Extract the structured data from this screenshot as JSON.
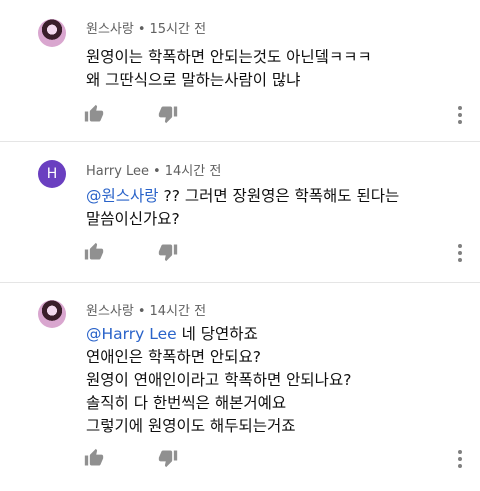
{
  "comments": [
    {
      "author": "원스사랑",
      "separator": "•",
      "time": "15시간 전",
      "avatar": "photo-avatar",
      "lines": [
        {
          "mention": "",
          "text": "원영이는 학폭하면 안되는것도 아닌뎈ㅋㅋㅋ"
        },
        {
          "mention": "",
          "text": "왜 그딴식으로 말하는사람이 많냐"
        }
      ]
    },
    {
      "author": "Harry Lee",
      "separator": "•",
      "time": "14시간 전",
      "avatar": "H",
      "avatar_color": "#6a3fc0",
      "lines": [
        {
          "mention": "@원스사랑",
          "text": " ?? 그러면 장원영은 학폭해도 된다는"
        },
        {
          "mention": "",
          "text": "말씀이신가요?"
        }
      ]
    },
    {
      "author": "원스사랑",
      "separator": "•",
      "time": "14시간 전",
      "avatar": "photo-avatar",
      "lines": [
        {
          "mention": "@Harry Lee",
          "text": " 네 당연하죠"
        },
        {
          "mention": "",
          "text": "연애인은 학폭하면 안되요?"
        },
        {
          "mention": "",
          "text": "원영이 연애인이라고 학폭하면 안되나요?"
        },
        {
          "mention": "",
          "text": "솔직히 다 한번씩은 해본거예요"
        },
        {
          "mention": "",
          "text": "그렇기에 원영이도 해두되는거죠"
        }
      ]
    }
  ],
  "icons": {
    "like": "thumbs-up-icon",
    "dislike": "thumbs-down-icon",
    "menu": "more-vertical-icon"
  },
  "colors": {
    "mention": "#2a63c9",
    "meta": "#606060",
    "text": "#0f0f0f",
    "avatar_h": "#6a3fc0"
  }
}
